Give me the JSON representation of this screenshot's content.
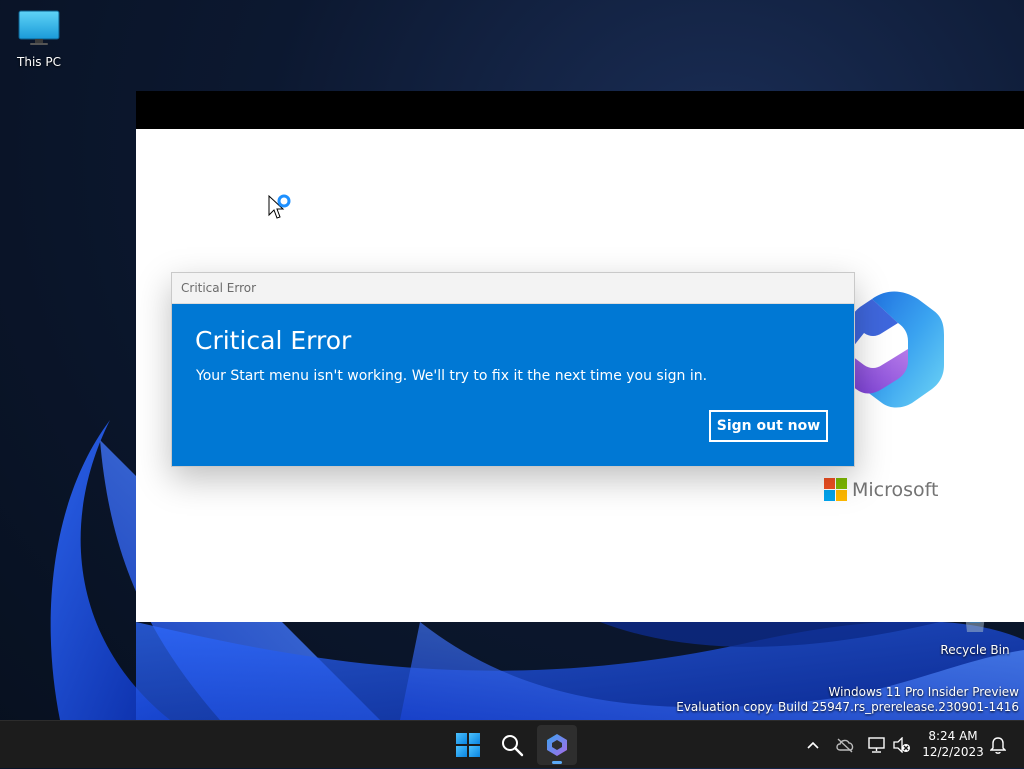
{
  "desktop": {
    "icons": [
      {
        "label": "This PC"
      },
      {
        "label": "Recycle Bin"
      }
    ]
  },
  "background_window": {
    "brand_text": "Microsoft"
  },
  "dialog": {
    "title": "Critical Error",
    "heading": "Critical Error",
    "message": "Your Start menu isn't working. We'll try to fix it the next time you sign in.",
    "button_label": "Sign out now",
    "accent_color": "#0078d4"
  },
  "watermark": {
    "line1": "Windows 11 Pro Insider Preview",
    "line2": "Evaluation copy. Build 25947.rs_prerelease.230901-1416"
  },
  "taskbar": {
    "pinned": [
      {
        "icon": "windows-start-icon"
      },
      {
        "icon": "search-icon"
      },
      {
        "icon": "copilot-icon",
        "active": true
      }
    ],
    "tray_icons": [
      "chevron-up-icon",
      "onedrive-cloud-offline-icon",
      "network-icon",
      "volume-muted-icon",
      "notification-bell-icon"
    ],
    "clock": {
      "time": "8:24 AM",
      "date": "12/2/2023"
    }
  }
}
